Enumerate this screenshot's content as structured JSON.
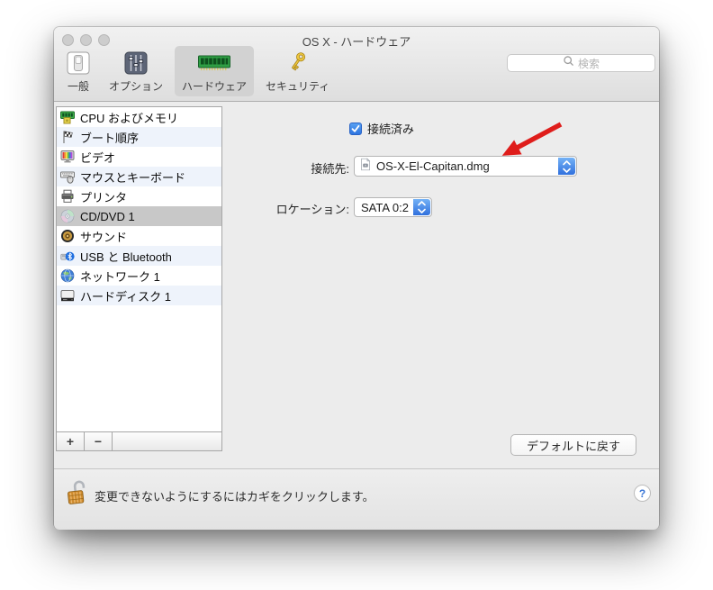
{
  "window_title": "OS X - ハードウェア",
  "toolbar": {
    "tabs": [
      {
        "label": "一般"
      },
      {
        "label": "オプション"
      },
      {
        "label": "ハードウェア",
        "selected": true
      },
      {
        "label": "セキュリティ"
      }
    ],
    "search_placeholder": "検索"
  },
  "sidebar": {
    "items": [
      {
        "label": "CPU およびメモリ"
      },
      {
        "label": "ブート順序"
      },
      {
        "label": "ビデオ"
      },
      {
        "label": "マウスとキーボード"
      },
      {
        "label": "プリンタ"
      },
      {
        "label": "CD/DVD 1",
        "selected": true
      },
      {
        "label": "サウンド"
      },
      {
        "label": "USB と Bluetooth"
      },
      {
        "label": "ネットワーク 1"
      },
      {
        "label": "ハードディスク 1"
      }
    ],
    "add_label": "+",
    "remove_label": "−"
  },
  "panel": {
    "connected": {
      "label": "接続済み",
      "checked": true
    },
    "connect_to": {
      "label": "接続先:",
      "value": "OS-X-El-Capitan.dmg"
    },
    "location": {
      "label": "ロケーション:",
      "value": "SATA 0:2"
    },
    "restore_defaults": "デフォルトに戻す"
  },
  "footer": {
    "lock_message": "変更できないようにするにはカギをクリックします。",
    "help_label": "?"
  },
  "annotation": {
    "arrow_color": "#df1d1b"
  },
  "colors": {
    "accent_blue": "#3a7fe0",
    "checkbox_blue": "#2e75e0",
    "selected_row_gray": "#c8c8c8",
    "alt_row_blue": "#eef3fb",
    "selected_tab_gray": "#d2d2d2",
    "window_bg": "#ececec"
  }
}
